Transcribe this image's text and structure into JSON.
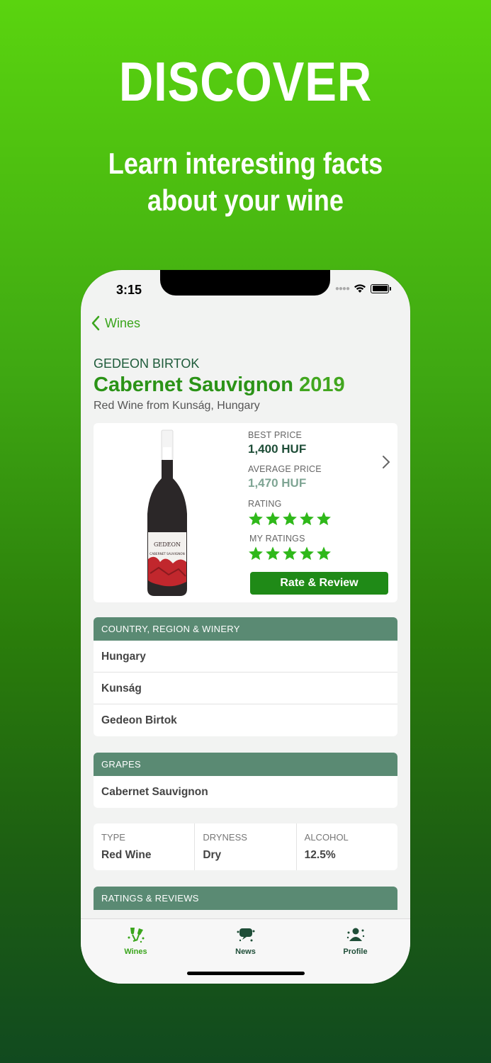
{
  "hero": {
    "title": "DISCOVER",
    "subtitle_line1": "Learn interesting facts",
    "subtitle_line2": "about your wine"
  },
  "status_bar": {
    "time": "3:15"
  },
  "nav": {
    "back_label": "Wines"
  },
  "wine": {
    "winery": "GEDEON BIRTOK",
    "name": "Cabernet Sauvignon",
    "year": "2019",
    "origin": "Red Wine from Kunság, Hungary",
    "bottle_label_brand": "GEDEON",
    "bottle_label_wine": "CABERNET SAUVIGNON"
  },
  "price_card": {
    "best_price_label": "BEST PRICE",
    "best_price": "1,400 HUF",
    "average_price_label": "AVERAGE PRICE",
    "average_price": "1,470 HUF",
    "rating_label": "RATING",
    "rating_stars": 5,
    "my_ratings_label": "MY RATINGS",
    "my_rating_stars": 5,
    "rate_button": "Rate & Review"
  },
  "sections": {
    "origin": {
      "header": "COUNTRY, REGION & WINERY",
      "rows": [
        "Hungary",
        "Kunság",
        "Gedeon Birtok"
      ]
    },
    "grapes": {
      "header": "GRAPES",
      "rows": [
        "Cabernet Sauvignon"
      ]
    },
    "ratings": {
      "header": "RATINGS & REVIEWS"
    }
  },
  "attributes": [
    {
      "label": "TYPE",
      "value": "Red Wine"
    },
    {
      "label": "DRYNESS",
      "value": "Dry"
    },
    {
      "label": "ALCOHOL",
      "value": "12.5%"
    }
  ],
  "tabs": [
    {
      "label": "Wines",
      "icon": "wine-glasses-icon",
      "active": true
    },
    {
      "label": "News",
      "icon": "news-icon",
      "active": false
    },
    {
      "label": "Profile",
      "icon": "profile-icon",
      "active": false
    }
  ],
  "colors": {
    "accent_green": "#3aa51c",
    "dark_green": "#1f4e38",
    "button_green": "#1f8a17",
    "section_header": "#5a8a73",
    "star_green": "#2fb81a"
  }
}
